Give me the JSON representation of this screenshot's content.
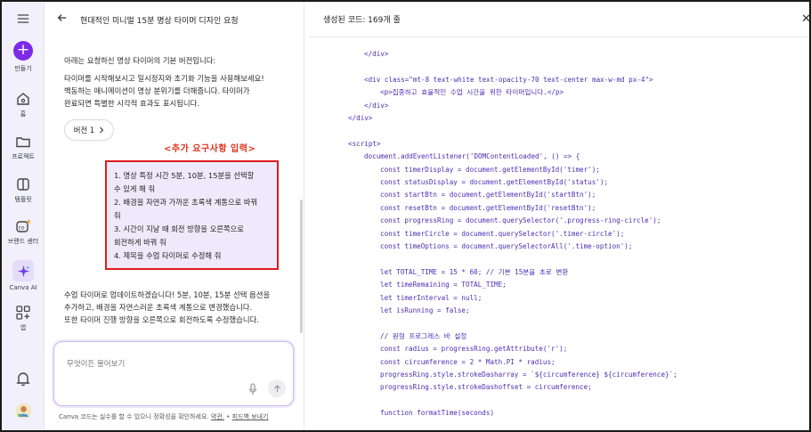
{
  "rail": {
    "create_label": "만들기",
    "home_label": "홈",
    "projects_label": "프로젝트",
    "templates_label": "템플릿",
    "brand_label": "브랜드 센터",
    "canva_ai_label": "Canva AI",
    "apps_label": "앱",
    "accent": "#7d2ae8"
  },
  "chat": {
    "title": "현대적인 미니멀 15분 명상 타이머 디자인 요청",
    "intro": "아래는 요청하신 명상 타이머의 기본 버전입니다:",
    "desc_lines": [
      "타이머를 시작해보시고 일시정지와 초기화 기능을 사용해보세요!",
      "백동하는 애니메이션이 명상 분위기를 더해줍니다. 타이머가",
      "완료되면 특별한 시각적 효과도 표시됩니다."
    ],
    "version_label": "버전 1",
    "req_heading": "<추가 요구사항 입력>",
    "req_lines": [
      "1. 명상 특정 시간 5분, 10분, 15분을 선택할",
      "수 있게 해 줘",
      "2. 배경을 자연과 가까운 초록색 계통으로 바꿔",
      "줘",
      "3. 시간이 지날 때 회전 방향을 오른쪽으로",
      "회전하게 바꿔 줘",
      "4. 제목을 수업 타이머로 수정해 줘"
    ],
    "reply_lines": [
      "수업 타이머로 업데이트하겠습니다! 5분, 10분, 15분 선택 옵션을",
      "추가하고, 배경을 자연스러운 초록색 계통으로 변경했습니다.",
      "또한 타이머 진행 방향을 오른쪽으로 회전하도록 수정했습니다."
    ],
    "input_placeholder": "무엇이든 물어보기",
    "footer_text": "Canva 코드는 실수를 할 수 있으니 정확성을 확인하세요.",
    "footer_terms": "약관.",
    "footer_sep": "•",
    "footer_feedback": "피드백 보내기",
    "highlight_color": "#e01b1b"
  },
  "code": {
    "title": "생성된 코드: 169개 줄",
    "lines": [
      {
        "indent": 2,
        "text": "</div>"
      },
      {
        "indent": 0,
        "text": ""
      },
      {
        "indent": 2,
        "text": "<div class=\"mt-8 text-white text-opacity-70 text-center max-w-md px-4\">"
      },
      {
        "indent": 3,
        "text": "<p>집중하고 효율적인 수업 시간을 위한 타이머입니다.</p>"
      },
      {
        "indent": 2,
        "text": "</div>"
      },
      {
        "indent": 1,
        "text": "</div>"
      },
      {
        "indent": 0,
        "text": ""
      },
      {
        "indent": 1,
        "text": "<script>"
      },
      {
        "indent": 2,
        "text": "document.addEventListener('DOMContentLoaded', () => {"
      },
      {
        "indent": 3,
        "text": "const timerDisplay = document.getElementById('timer');"
      },
      {
        "indent": 3,
        "text": "const statusDisplay = document.getElementById('status');"
      },
      {
        "indent": 3,
        "text": "const startBtn = document.getElementById('startBtn');"
      },
      {
        "indent": 3,
        "text": "const resetBtn = document.getElementById('resetBtn');"
      },
      {
        "indent": 3,
        "text": "const progressRing = document.querySelector('.progress-ring-circle');"
      },
      {
        "indent": 3,
        "text": "const timerCircle = document.querySelector('.timer-circle');"
      },
      {
        "indent": 3,
        "text": "const timeOptions = document.querySelectorAll('.time-option');"
      },
      {
        "indent": 0,
        "text": ""
      },
      {
        "indent": 3,
        "text": "let TOTAL_TIME = 15 * 60; // 기본 15분을 초로 변환"
      },
      {
        "indent": 3,
        "text": "let timeRemaining = TOTAL_TIME;"
      },
      {
        "indent": 3,
        "text": "let timerInterval = null;"
      },
      {
        "indent": 3,
        "text": "let isRunning = false;"
      },
      {
        "indent": 0,
        "text": ""
      },
      {
        "indent": 3,
        "text": "// 원형 프로그레스 바 설정"
      },
      {
        "indent": 3,
        "text": "const radius = progressRing.getAttribute('r');"
      },
      {
        "indent": 3,
        "text": "const circumference = 2 * Math.PI * radius;"
      },
      {
        "indent": 3,
        "text": "progressRing.style.strokeDasharray = `${circumference} ${circumference}`;"
      },
      {
        "indent": 3,
        "text": "progressRing.style.strokeDashoffset = circumference;"
      },
      {
        "indent": 0,
        "text": ""
      },
      {
        "indent": 3,
        "text": "function formatTime(seconds)"
      }
    ]
  }
}
